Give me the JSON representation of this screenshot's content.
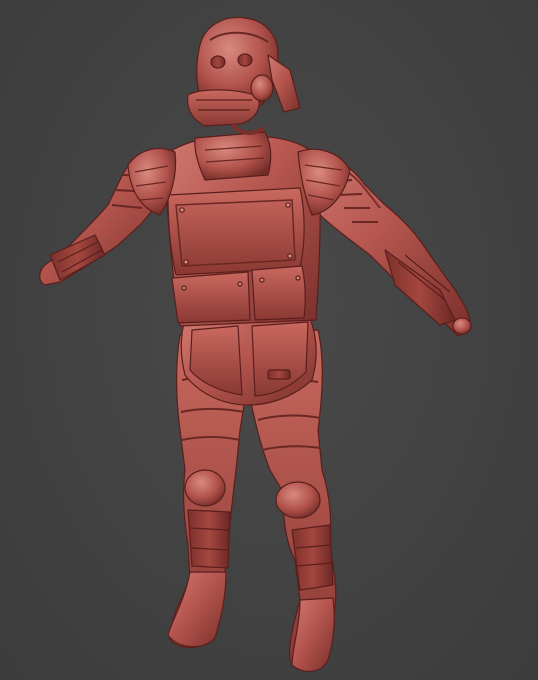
{
  "scene": {
    "background_color": "#424242",
    "material": {
      "base_color": "#b5564f",
      "shadow_color": "#6f2a27",
      "highlight_color": "#d9867d",
      "line_color": "#5a1f1c"
    },
    "subject": "sculpted-armored-figure"
  }
}
